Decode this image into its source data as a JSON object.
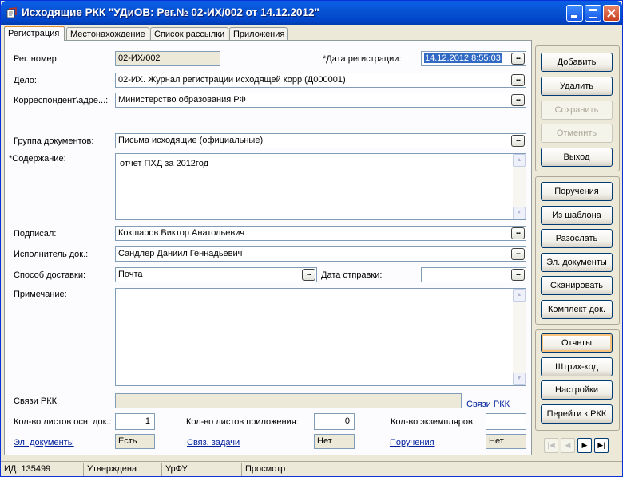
{
  "window": {
    "title": "Исходящие РКК \"УДиОВ: Рег.№ 02-ИХ/002 от 14.12.2012\""
  },
  "tabs": [
    {
      "label": "Регистрация",
      "active": true
    },
    {
      "label": "Местонахождение",
      "active": false
    },
    {
      "label": "Список рассылки",
      "active": false
    },
    {
      "label": "Приложения",
      "active": false
    }
  ],
  "form": {
    "reg_number": {
      "label": "Рег. номер:",
      "value": "02-ИХ/002"
    },
    "reg_date": {
      "label": "*Дата регистрации:",
      "value": "14.12.2012 8:55:03"
    },
    "case": {
      "label": "Дело:",
      "value": "02-ИХ. Журнал регистрации исходящей корр (Д000001)"
    },
    "correspondent": {
      "label": "Корреспондент\\адре...:",
      "value": "Министерство образования РФ"
    },
    "doc_group": {
      "label": "Группа документов:",
      "value": "Письма исходящие (официальные)"
    },
    "content": {
      "label": "*Содержание:",
      "value": "отчет ПХД за 2012год"
    },
    "signed_by": {
      "label": "Подписал:",
      "value": "Кокшаров Виктор Анатольевич"
    },
    "executor": {
      "label": "Исполнитель док.:",
      "value": "Сандлер Даниил Геннадьевич"
    },
    "delivery": {
      "label": "Способ доставки:",
      "value": "Почта"
    },
    "send_date": {
      "label": "Дата отправки:",
      "value": ""
    },
    "note": {
      "label": "Примечание:",
      "value": ""
    },
    "links": {
      "label": "Связи РКК:",
      "link": "Связи РКК"
    },
    "main_sheets": {
      "label": "Кол-во листов осн. док.:",
      "value": "1"
    },
    "attach_sheets": {
      "label": "Кол-во листов приложения:",
      "value": "0"
    },
    "copies": {
      "label": "Кол-во экземпляров:",
      "value": ""
    },
    "el_docs": {
      "link": "Эл. документы",
      "value": "Есть"
    },
    "related_tasks": {
      "link": "Связ. задачи",
      "value": "Нет"
    },
    "instructions": {
      "link": "Поручения",
      "value": "Нет"
    }
  },
  "buttons": {
    "group1": [
      {
        "name": "add-button",
        "label": "Добавить",
        "enabled": true
      },
      {
        "name": "delete-button",
        "label": "Удалить",
        "enabled": true
      },
      {
        "name": "save-button",
        "label": "Сохранить",
        "enabled": false
      },
      {
        "name": "cancel-button",
        "label": "Отменить",
        "enabled": false
      },
      {
        "name": "exit-button",
        "label": "Выход",
        "enabled": true
      }
    ],
    "group2": [
      {
        "name": "instructions-button",
        "label": "Поручения"
      },
      {
        "name": "from-template-button",
        "label": "Из шаблона"
      },
      {
        "name": "send-out-button",
        "label": "Разослать"
      },
      {
        "name": "el-documents-button",
        "label": "Эл. документы"
      },
      {
        "name": "scan-button",
        "label": "Сканировать"
      },
      {
        "name": "doc-set-button",
        "label": "Комплект док."
      }
    ],
    "group3": [
      {
        "name": "reports-button",
        "label": "Отчеты"
      },
      {
        "name": "barcode-button",
        "label": "Штрих-код"
      },
      {
        "name": "settings-button",
        "label": "Настройки"
      },
      {
        "name": "goto-rkk-button",
        "label": "Перейти к РКК"
      }
    ]
  },
  "statusbar": {
    "id": "ИД: 135499",
    "state": "Утверждена",
    "org": "УрФУ",
    "mode": "Просмотр"
  }
}
